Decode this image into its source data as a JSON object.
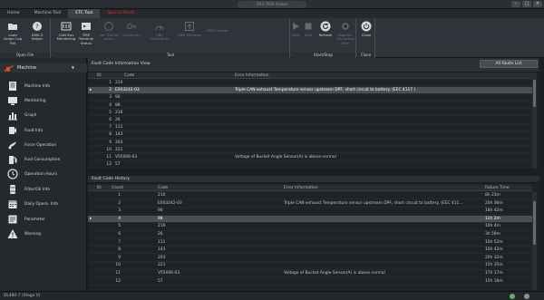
{
  "window": {
    "title": "DR3 7000 Viewer"
  },
  "tabs": [
    {
      "label": "Home"
    },
    {
      "label": "Machine Tool"
    },
    {
      "label": "ETC Tool"
    },
    {
      "label": "Special Mode"
    }
  ],
  "ribbon": {
    "open_file": {
      "name": "Open File",
      "load_graph": "Load Graph Log File",
      "dms5_helper": "DMS-5 Helper"
    },
    "tool": {
      "name": "Tool",
      "can_bus": "CAN Bus Monitoring",
      "tms_terminal": "TMS Terminal Status",
      "set_thumbwheel": "Set Thumb wheel",
      "smart_key": "Smart key",
      "ebc_calibration": "EBC Calibration",
      "vmm_manager": "VMM Manager",
      "dms_cluster": "DMS Cluster"
    },
    "start_stop": {
      "name": "Start/Stop",
      "start": "Start",
      "stop": "Stop",
      "refresh": "Refresh",
      "register_recording": "Register Recording Item"
    },
    "close": {
      "name": "Close",
      "close": "Close"
    }
  },
  "sidebar": {
    "machine": "Machine",
    "items": [
      {
        "label": "Machine Info",
        "icon": "info-icon"
      },
      {
        "label": "Monitoring",
        "icon": "monitor-icon"
      },
      {
        "label": "Graph",
        "icon": "graph-icon"
      },
      {
        "label": "Fault Info",
        "icon": "fault-icon"
      },
      {
        "label": "Force Operation",
        "icon": "force-icon"
      },
      {
        "label": "Fuel Consumption",
        "icon": "fuel-icon"
      },
      {
        "label": "Operation Hours",
        "icon": "clock-icon"
      },
      {
        "label": "Filter/Oil Info",
        "icon": "filter-icon"
      },
      {
        "label": "Daily Opera. Info",
        "icon": "calendar-icon"
      },
      {
        "label": "Parameter",
        "icon": "parameter-icon"
      },
      {
        "label": "Warning",
        "icon": "warning-icon"
      }
    ]
  },
  "status": {
    "text": "DL480-7 (Stage V)"
  },
  "fault_view": {
    "title": "Fault Code Information View",
    "all_faults_button": "All Faults List",
    "columns": [
      "ID",
      "Code",
      "Error Information"
    ],
    "rows": [
      {
        "id": "1",
        "code": "210",
        "info": ""
      },
      {
        "id": "2",
        "code": "E003242-03",
        "info": "Triple CAN exhaust Temperature sensor upstream DPF, short circuit to battery. (EEC 4117 )"
      },
      {
        "id": "3",
        "code": "90",
        "info": ""
      },
      {
        "id": "4",
        "code": "88",
        "info": ""
      },
      {
        "id": "5",
        "code": "216",
        "info": ""
      },
      {
        "id": "6",
        "code": "26",
        "info": ""
      },
      {
        "id": "7",
        "code": "111",
        "info": ""
      },
      {
        "id": "8",
        "code": "143",
        "info": ""
      },
      {
        "id": "9",
        "code": "203",
        "info": ""
      },
      {
        "id": "10",
        "code": "221",
        "info": ""
      },
      {
        "id": "11",
        "code": "V55006-03",
        "info": "Voltage of Bucket Angle Sensor(A) is above normal"
      },
      {
        "id": "12",
        "code": "57",
        "info": ""
      }
    ]
  },
  "fault_history": {
    "title": "Fault Code History",
    "columns": [
      "ID",
      "Count",
      "Code",
      "Error Information",
      "Failure Time"
    ],
    "rows": [
      {
        "id": "1",
        "count": "",
        "code": "210",
        "info": "",
        "time": "8h 23m"
      },
      {
        "id": "2",
        "count": "",
        "code": "E003242-03",
        "info": "Triple CAN exhaust Temperature sensor upstream DPF, short circuit to battery. (EEC 411...",
        "time": "20h 36m"
      },
      {
        "id": "3",
        "count": "",
        "code": "90",
        "info": "",
        "time": "18h 42m"
      },
      {
        "id": "4",
        "count": "",
        "code": "88",
        "info": "",
        "time": "12h 2m"
      },
      {
        "id": "5",
        "count": "",
        "code": "216",
        "info": "",
        "time": "10h 4m"
      },
      {
        "id": "6",
        "count": "",
        "code": "26",
        "info": "",
        "time": "3h 59m"
      },
      {
        "id": "7",
        "count": "",
        "code": "111",
        "info": "",
        "time": "10h 52m"
      },
      {
        "id": "8",
        "count": "",
        "code": "143",
        "info": "",
        "time": "10h 42m"
      },
      {
        "id": "9",
        "count": "",
        "code": "203",
        "info": "",
        "time": "20h 32m"
      },
      {
        "id": "10",
        "count": "",
        "code": "221",
        "info": "",
        "time": "15h 35m"
      },
      {
        "id": "11",
        "count": "",
        "code": "V55006-03",
        "info": "Voltage of Bucket Angle Sensor(A) is above normal",
        "time": "17h 17m"
      },
      {
        "id": "12",
        "count": "",
        "code": "57",
        "info": "",
        "time": "15h 18m"
      }
    ]
  },
  "colors": {
    "accent_tab": "#d8323a",
    "selected_row": "#4a4e55",
    "machine_icon": "#e0562a"
  }
}
